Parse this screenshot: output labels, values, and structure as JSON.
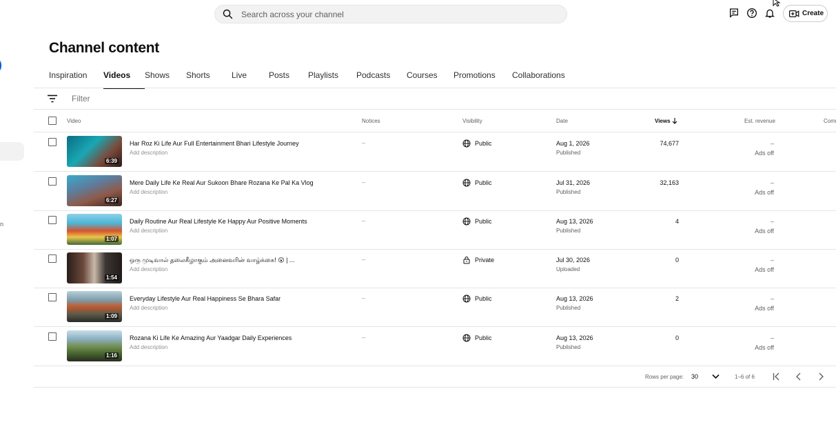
{
  "search": {
    "placeholder": "Search across your channel"
  },
  "header": {
    "create_label": "Create"
  },
  "page_title": "Channel content",
  "tabs": [
    {
      "label": "Inspiration",
      "active": false
    },
    {
      "label": "Videos",
      "active": true
    },
    {
      "label": "Shows",
      "active": false
    },
    {
      "label": "Shorts",
      "active": false
    },
    {
      "label": "Live",
      "active": false
    },
    {
      "label": "Posts",
      "active": false
    },
    {
      "label": "Playlists",
      "active": false
    },
    {
      "label": "Podcasts",
      "active": false
    },
    {
      "label": "Courses",
      "active": false
    },
    {
      "label": "Promotions",
      "active": false
    },
    {
      "label": "Collaborations",
      "active": false
    }
  ],
  "filter": {
    "placeholder": "Filter"
  },
  "sidebar": {
    "truncated_text": "n"
  },
  "columns": {
    "video": "Video",
    "notices": "Notices",
    "visibility": "Visibility",
    "date": "Date",
    "views": "Views",
    "revenue": "Est. revenue",
    "comments": "Comm"
  },
  "videos": [
    {
      "title": "Har Roz Ki Life Aur Full Entertainment Bhari Lifestyle Journey",
      "description": "Add description",
      "duration": "6:39",
      "notice": "–",
      "visibility": "Public",
      "date": "Aug 1, 2026",
      "status": "Published",
      "views": "74,677",
      "revenue": "–",
      "ads": "Ads off"
    },
    {
      "title": "Mere Daily Life Ke Real Aur Sukoon Bhare Rozana Ke Pal Ka Vlog",
      "description": "Add description",
      "duration": "6:27",
      "notice": "–",
      "visibility": "Public",
      "date": "Jul 31, 2026",
      "status": "Published",
      "views": "32,163",
      "revenue": "–",
      "ads": "Ads off"
    },
    {
      "title": "Daily Routine Aur Real Lifestyle Ke Happy Aur Positive Moments",
      "description": "Add description",
      "duration": "1:07",
      "notice": "–",
      "visibility": "Public",
      "date": "Aug 13, 2026",
      "status": "Published",
      "views": "4",
      "revenue": "–",
      "ads": "Ads off"
    },
    {
      "title": "ஒரு முடிவால் தலைகீழாகும் அனைவரின் வாழ்க்கை! 😮 | ...",
      "description": "Add description",
      "duration": "1:54",
      "notice": "–",
      "visibility": "Private",
      "date": "Jul 30, 2026",
      "status": "Uploaded",
      "views": "0",
      "revenue": "–",
      "ads": "Ads off"
    },
    {
      "title": "Everyday Lifestyle Aur Real Happiness Se Bhara Safar",
      "description": "Add description",
      "duration": "1:09",
      "notice": "–",
      "visibility": "Public",
      "date": "Aug 13, 2026",
      "status": "Published",
      "views": "2",
      "revenue": "–",
      "ads": "Ads off"
    },
    {
      "title": "Rozana Ki Life Ke Amazing Aur Yaadgar Daily Experiences",
      "description": "Add description",
      "duration": "1:16",
      "notice": "–",
      "visibility": "Public",
      "date": "Aug 13, 2026",
      "status": "Published",
      "views": "0",
      "revenue": "–",
      "ads": "Ads off"
    }
  ],
  "pagination": {
    "rows_label": "Rows per page:",
    "rows_value": "30",
    "range": "1–6 of 6"
  }
}
